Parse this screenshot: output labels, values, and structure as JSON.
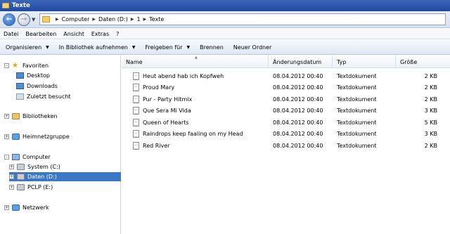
{
  "window": {
    "title": "Texte"
  },
  "address": {
    "crumbs": [
      "Computer",
      "Daten (D:)",
      "1",
      "Texte"
    ]
  },
  "menu": [
    "Datei",
    "Bearbeiten",
    "Ansicht",
    "Extras",
    "?"
  ],
  "toolbar": {
    "organize": "Organisieren",
    "library": "In Bibliothek aufnehmen",
    "share": "Freigeben für",
    "burn": "Brennen",
    "newfolder": "Neuer Ordner"
  },
  "nav": {
    "favorites": "Favoriten",
    "desktop": "Desktop",
    "downloads": "Downloads",
    "recent": "Zuletzt besucht",
    "libraries": "Bibliotheken",
    "homegroup": "Heimnetzgruppe",
    "computer": "Computer",
    "system": "System (C:)",
    "data": "Daten (D:)",
    "pclp": "PCLP (E:)",
    "network": "Netzwerk"
  },
  "columns": {
    "name": "Name",
    "date": "Änderungsdatum",
    "type": "Typ",
    "size": "Größe"
  },
  "files": [
    {
      "name": "Heut abend hab ich Kopfweh",
      "date": "08.04.2012 00:40",
      "type": "Textdokument",
      "size": "2 KB"
    },
    {
      "name": "Proud Mary",
      "date": "08.04.2012 00:40",
      "type": "Textdokument",
      "size": "2 KB"
    },
    {
      "name": "Pur - Party Hitmix",
      "date": "08.04.2012 00:40",
      "type": "Textdokument",
      "size": "2 KB"
    },
    {
      "name": "Que Sera Mi Vida",
      "date": "08.04.2012 00:40",
      "type": "Textdokument",
      "size": "3 KB"
    },
    {
      "name": "Queen of Hearts",
      "date": "08.04.2012 00:40",
      "type": "Textdokument",
      "size": "5 KB"
    },
    {
      "name": "Raindrops keep faaling on my Head",
      "date": "08.04.2012 00:40",
      "type": "Textdokument",
      "size": "3 KB"
    },
    {
      "name": "Red River",
      "date": "08.04.2012 00:40",
      "type": "Textdokument",
      "size": "2 KB"
    }
  ]
}
